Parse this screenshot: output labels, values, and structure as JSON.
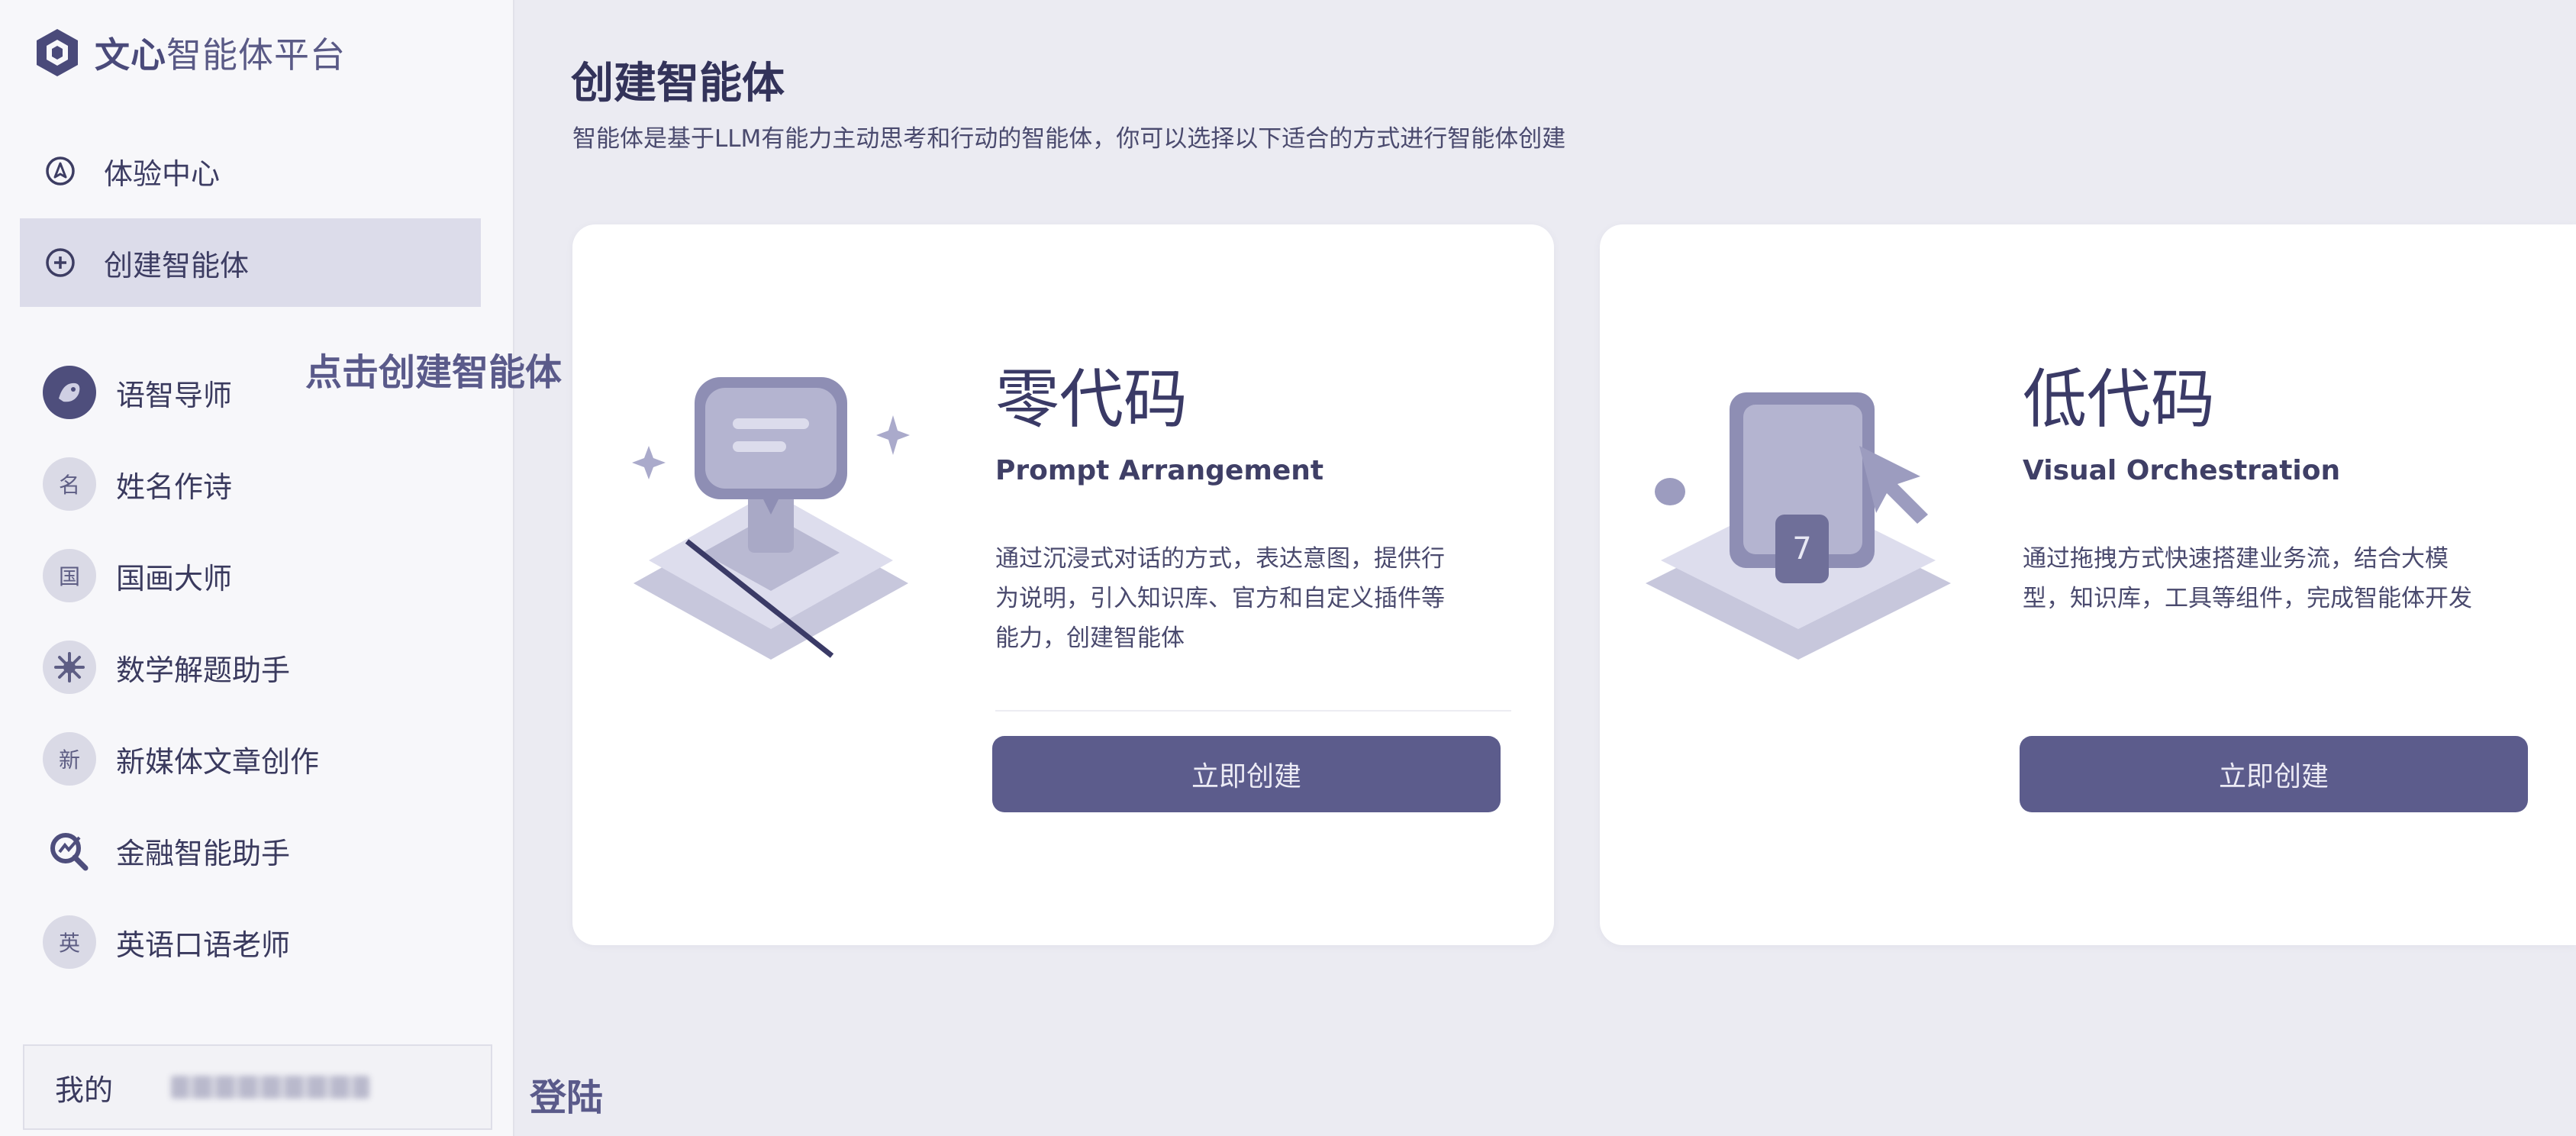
{
  "brand": {
    "bold": "文心",
    "rest": "智能体平台"
  },
  "nav": [
    {
      "label": "体验中心",
      "icon": "compass-icon"
    },
    {
      "label": "创建智能体",
      "icon": "plus-circle-icon",
      "active": true
    }
  ],
  "hint": "点击创建智能体",
  "agents": [
    {
      "label": "语智导师",
      "avatar": ""
    },
    {
      "label": "姓名作诗",
      "avatar": "名"
    },
    {
      "label": "国画大师",
      "avatar": "国"
    },
    {
      "label": "数学解题助手",
      "avatar": ""
    },
    {
      "label": "新媒体文章创作",
      "avatar": "新"
    },
    {
      "label": "金融智能助手",
      "avatar": ""
    },
    {
      "label": "英语口语老师",
      "avatar": "英"
    }
  ],
  "bottom": {
    "mine_label": "我的",
    "login_label": "登陆"
  },
  "main": {
    "title": "创建智能体",
    "subtitle": "智能体是基于LLM有能力主动思考和行动的智能体，你可以选择以下适合的方式进行智能体创建"
  },
  "cards": {
    "zero_code": {
      "title": "零代码",
      "subtitle": "Prompt Arrangement",
      "desc_lines": [
        "通过沉浸式对话的方式，表达意图，提供行",
        "为说明，引入知识库、官方和自定义插件等",
        "能力，创建智能体"
      ],
      "button": "立即创建"
    },
    "low_code": {
      "title": "低代码",
      "subtitle": "Visual Orchestration",
      "desc_lines": [
        "通过拖拽方式快速搭建业务流，结合大模",
        "型，知识库，工具等组件，完成智能体开发"
      ],
      "button": "立即创建"
    }
  },
  "colors": {
    "accent": "#5c5c8c",
    "sidebar_bg": "#f7f7fa",
    "page_bg": "#ebebf2",
    "active_nav": "#dcdcea"
  }
}
